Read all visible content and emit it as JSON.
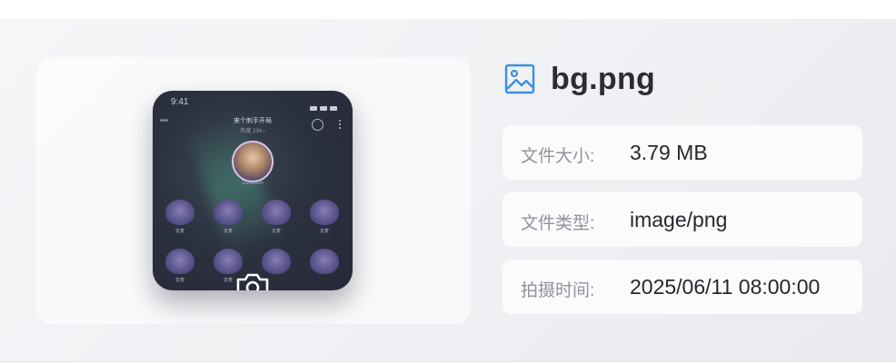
{
  "file": {
    "name": "bg.png",
    "icon": "image-icon",
    "accent_color": "#3d8fe0"
  },
  "details": [
    {
      "label": "文件大小:",
      "value": "3.79 MB"
    },
    {
      "label": "文件类型:",
      "value": "image/png"
    },
    {
      "label": "拍摄时间:",
      "value": "2025/06/11 08:00:00"
    }
  ],
  "preview": {
    "status_time": "9:41",
    "room_title": "来个刺手开局",
    "room_sub": "热度 234 ›",
    "host_name": "DJJason",
    "seat_label": "去麦",
    "overlay_icon": "camera-icon"
  }
}
